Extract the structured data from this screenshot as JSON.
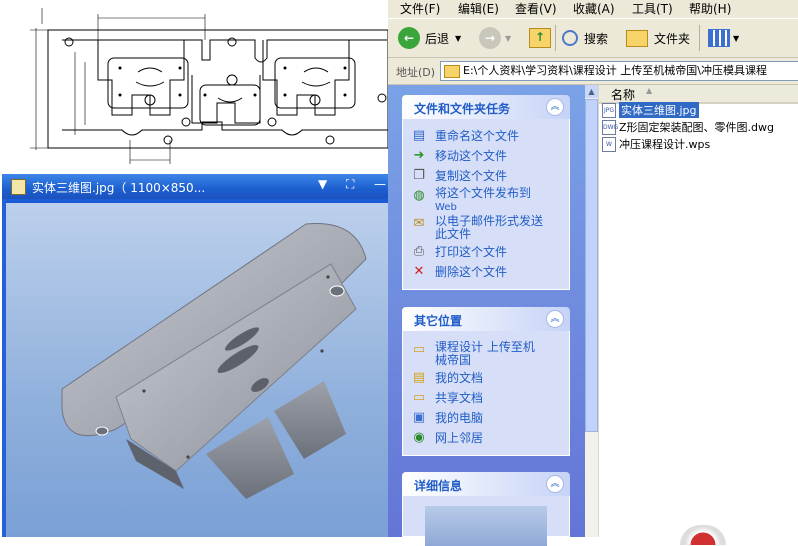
{
  "viewer": {
    "title": "实体三维图.jpg（ 1100×850...",
    "ctrl_menu": "▼",
    "ctrl_fullscreen": "⛶",
    "ctrl_min": "—"
  },
  "explorer": {
    "menu": [
      "文件(F)",
      "编辑(E)",
      "查看(V)",
      "收藏(A)",
      "工具(T)",
      "帮助(H)"
    ],
    "toolbar": {
      "back": "后退",
      "search": "搜索",
      "folders": "文件夹"
    },
    "address": {
      "label": "地址(D)",
      "path": "E:\\个人资料\\学习资料\\课程设计 上传至机械帝国\\冲压模具课程"
    },
    "panels": {
      "tasks": {
        "title": "文件和文件夹任务",
        "items": [
          "重命名这个文件",
          "移动这个文件",
          "复制这个文件",
          "将这个文件发布到",
          "以电子邮件形式发送",
          "打印这个文件",
          "删除这个文件"
        ],
        "sub": [
          "Web",
          "此文件"
        ]
      },
      "places": {
        "title": "其它位置",
        "items": [
          "课程设计 上传至机",
          "我的文档",
          "共享文档",
          "我的电脑",
          "网上邻居"
        ],
        "sub": [
          "械帝国"
        ]
      },
      "details": {
        "title": "详细信息"
      }
    },
    "files": {
      "column_name": "名称",
      "rows": [
        "实体三维图.jpg",
        "Z形固定架装配图、零件图.dwg",
        "冲压课程设计.wps"
      ],
      "selected_index": 0
    }
  }
}
